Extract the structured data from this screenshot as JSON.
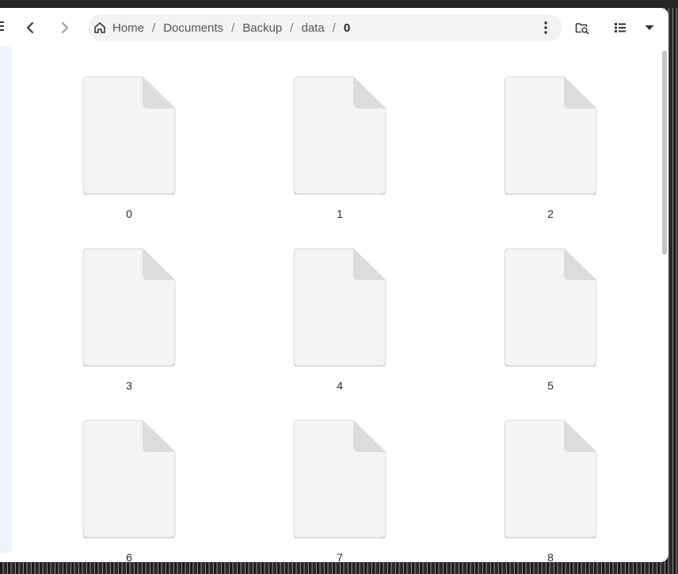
{
  "breadcrumb": {
    "items": [
      "Home",
      "Documents",
      "Backup",
      "data"
    ],
    "current": "0",
    "separator": "/"
  },
  "files": [
    {
      "name": "0"
    },
    {
      "name": "1"
    },
    {
      "name": "2"
    },
    {
      "name": "3"
    },
    {
      "name": "4"
    },
    {
      "name": "5"
    },
    {
      "name": "6"
    },
    {
      "name": "7"
    },
    {
      "name": "8"
    }
  ],
  "icons": {
    "back": "chevron-left-icon",
    "forward": "chevron-right-icon",
    "home": "home-icon",
    "path_menu": "kebab-menu-icon",
    "search": "folder-search-icon",
    "view": "list-view-icon",
    "view_options": "chevron-down-icon"
  },
  "colors": {
    "pathbar_bg": "#f3f3f3",
    "file_icon": "#f4f4f4",
    "file_fold": "#dedcda",
    "sidebar": "#eef3fc"
  }
}
